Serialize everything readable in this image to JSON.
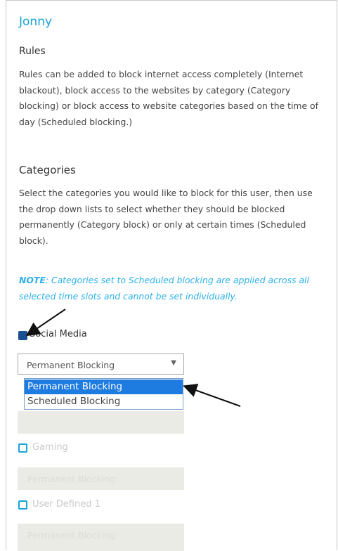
{
  "user": {
    "name": "Jonny"
  },
  "rules": {
    "heading": "Rules",
    "description": "Rules can be added to block internet access completely (Internet blackout), block access to the websites by category (Category blocking) or block access to website categories based on the time of day (Scheduled blocking.)"
  },
  "categories": {
    "heading": "Categories",
    "description": "Select the categories you would like to block for this user, then use the drop down lists to select whether they should be blocked permanently (Category block) or only at certain times (Scheduled block).",
    "note_label": "NOTE",
    "note_text": ": Categories set to Scheduled blocking are applied across all selected time slots and cannot be set individually.",
    "items": [
      {
        "label": "Social Media",
        "checked": true,
        "select_value": "Permanent Blocking",
        "select_options": [
          "Permanent Blocking",
          "Scheduled Blocking"
        ],
        "dropdown_open": true,
        "highlighted_option": "Permanent Blocking"
      },
      {
        "label": "Gaming",
        "checked": false,
        "select_value": "Permanent Blocking"
      },
      {
        "label": "User Defined 1",
        "checked": false,
        "select_value": "Permanent Blocking"
      }
    ],
    "third_category_select_value": "Permanent Blocking"
  },
  "colors": {
    "accent": "#1aa3d9",
    "checkbox_checked": "#1a4f93",
    "dropdown_highlight": "#1e7be0",
    "disabled_select_bg": "#ebebe6"
  },
  "icons": [
    "chevron-down-icon",
    "annotation-arrow-icon"
  ]
}
